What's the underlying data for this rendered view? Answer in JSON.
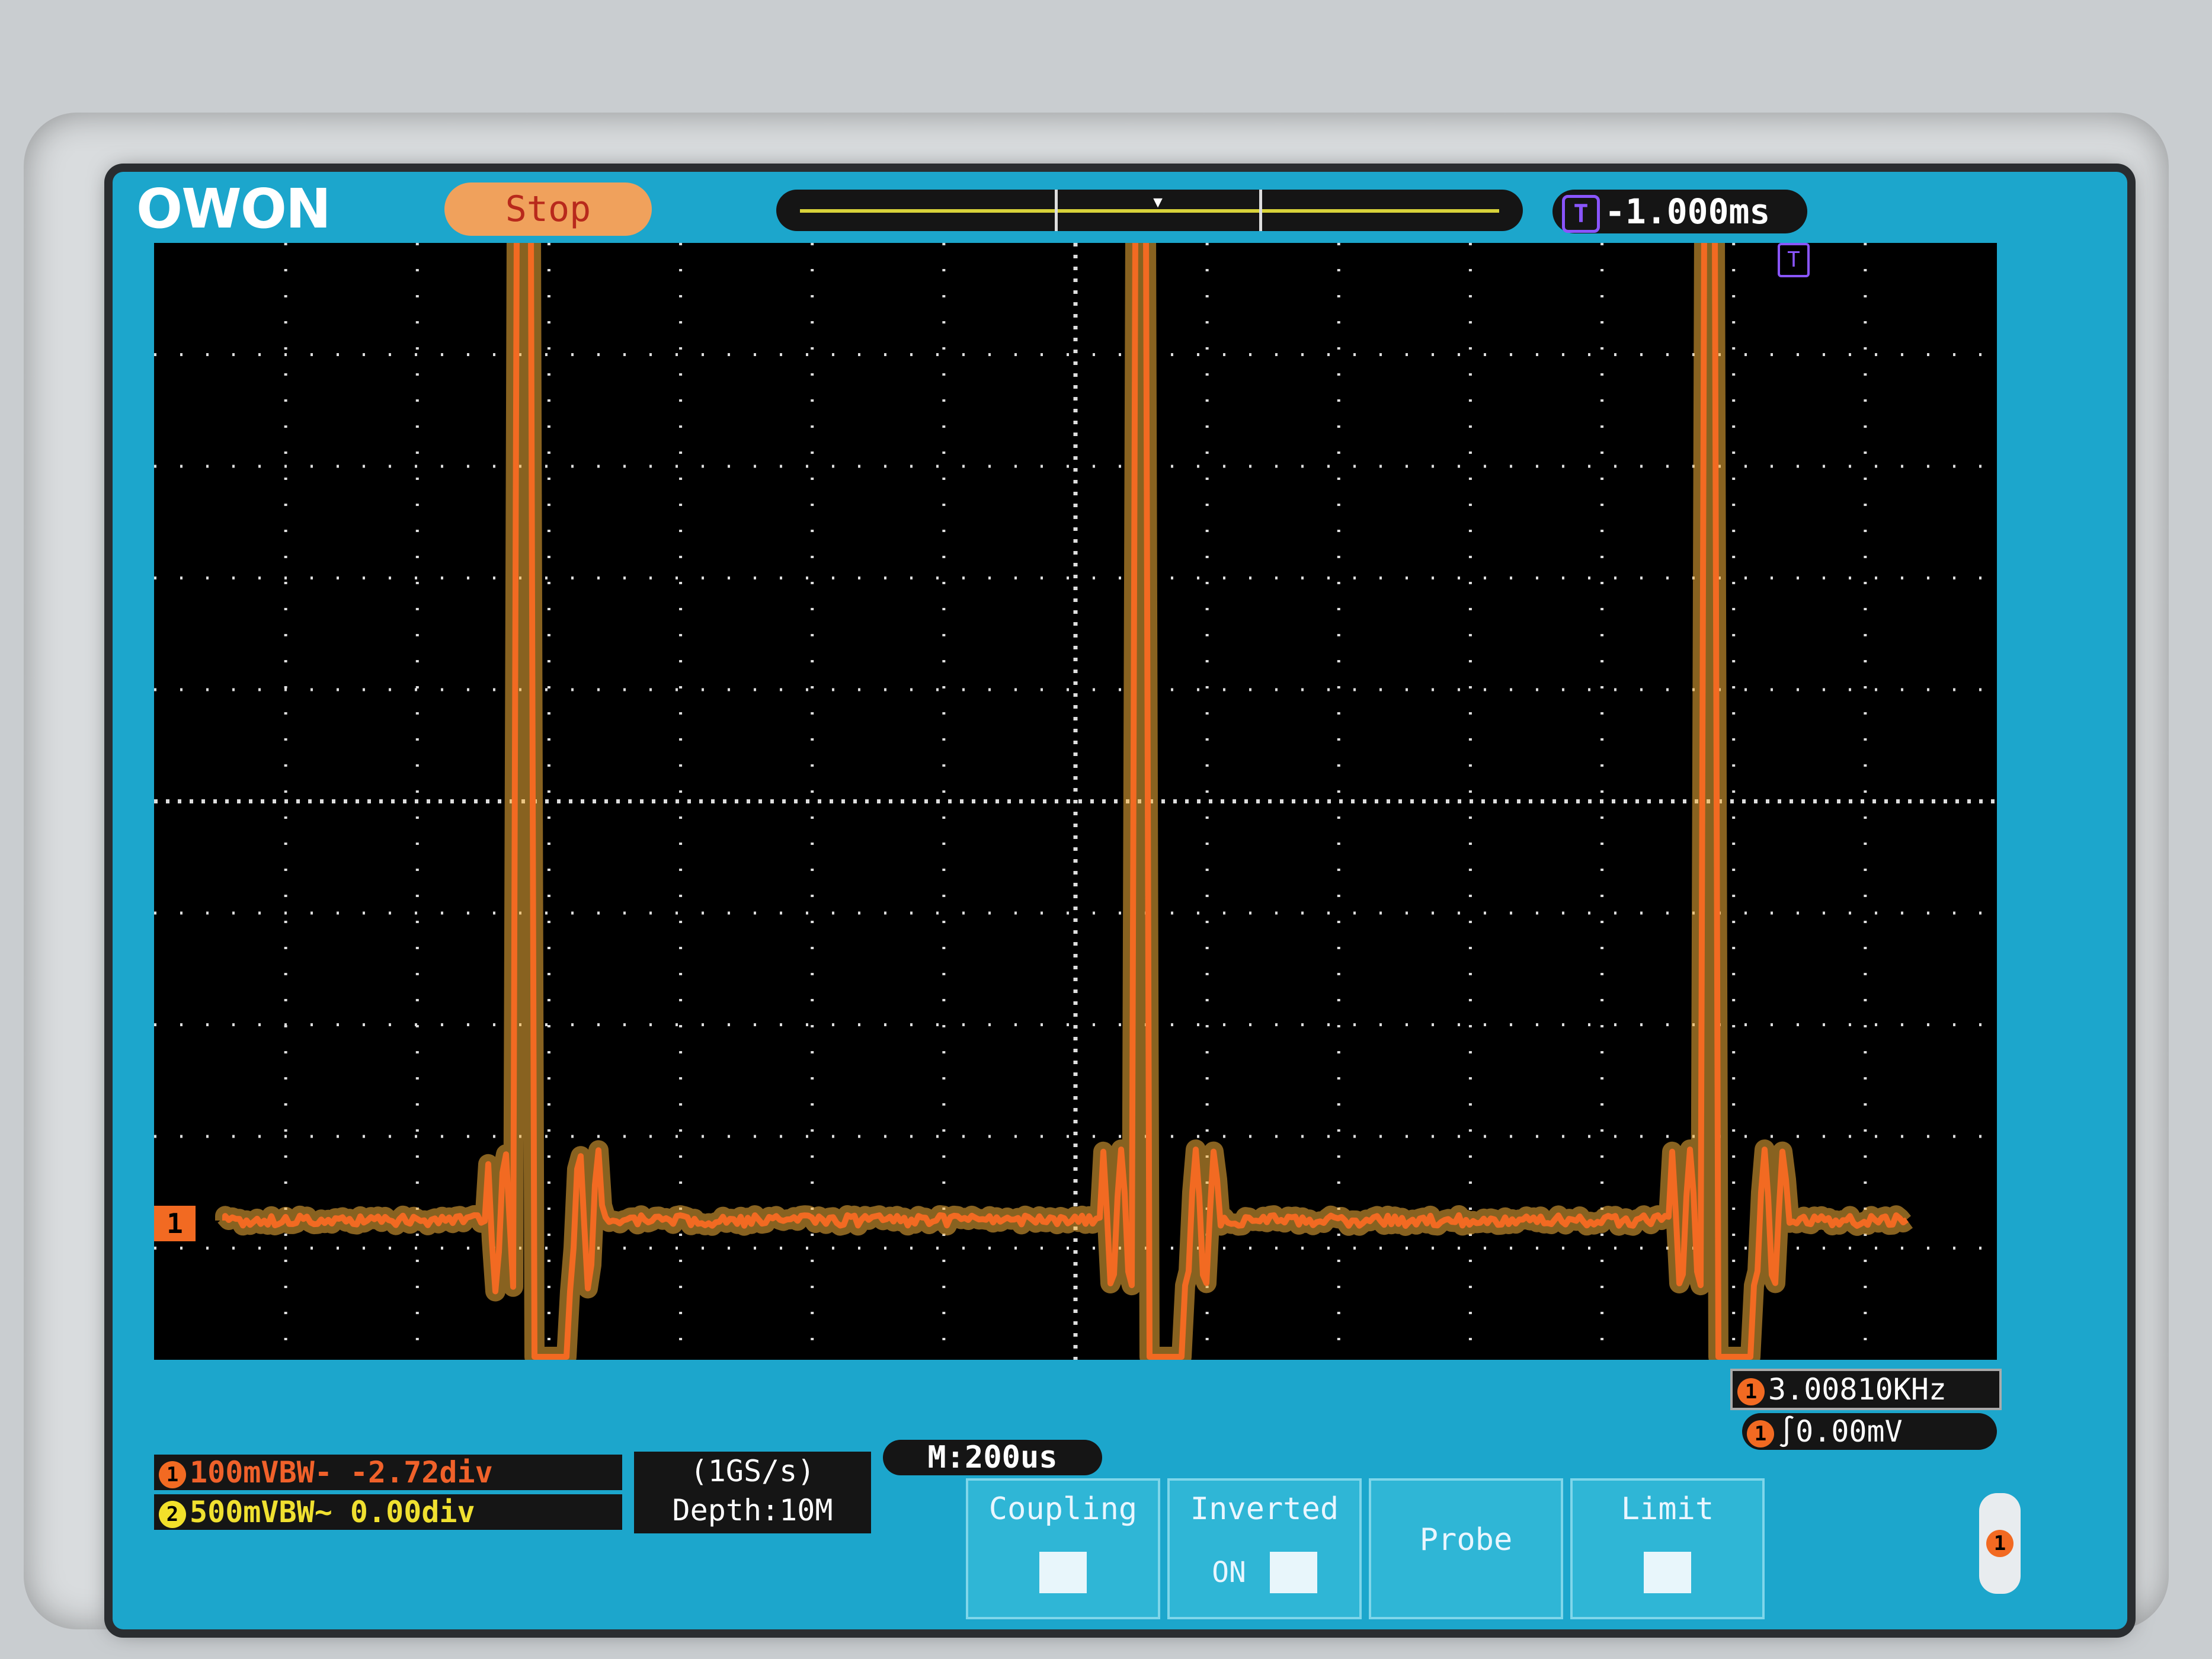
{
  "header": {
    "logo": "OWON",
    "run_status": "Stop",
    "trigger_delay": "-1.000ms",
    "trigger_badge": "T"
  },
  "display": {
    "channel_marker": "1",
    "trace_color": "#f26a22",
    "grid_color": "#dddddd",
    "frequency": "3.00810KHz",
    "trigger_level_channel": "1",
    "trigger_level": "0.00mV"
  },
  "channels": [
    {
      "num": "1",
      "text": "100mVBW- -2.72div",
      "color": "#f0612a"
    },
    {
      "num": "2",
      "text": "500mVBW~ 0.00div",
      "color": "#f0e030"
    }
  ],
  "acquisition": {
    "rate": "(1GS/s)",
    "depth": "Depth:10M"
  },
  "timebase": "M:200us",
  "menu": {
    "coupling": "Coupling",
    "inverted": "Inverted",
    "inverted_state": "ON",
    "probe": "Probe",
    "limit": "Limit"
  },
  "side_selector": "1"
}
